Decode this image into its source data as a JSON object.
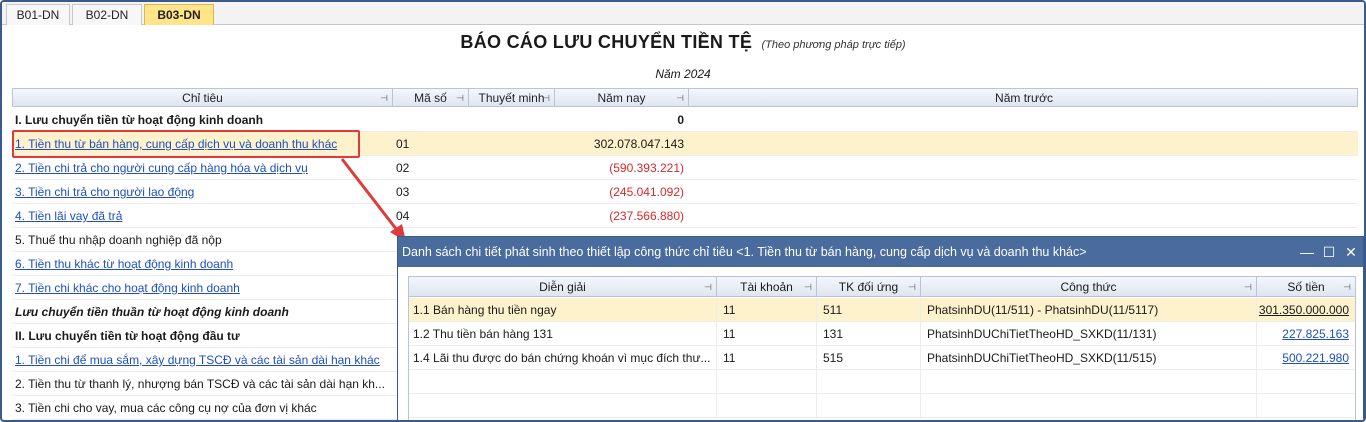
{
  "tabs": [
    "B01-DN",
    "B02-DN",
    "B03-DN"
  ],
  "report": {
    "title": "BÁO CÁO LƯU CHUYỂN TIỀN TỆ",
    "subtitle": "(Theo phương pháp trực tiếp)",
    "year": "Năm 2024"
  },
  "grid": {
    "headers": [
      "Chỉ tiêu",
      "Mã số",
      "Thuyết minh",
      "Năm nay",
      "Năm trước"
    ],
    "rows": [
      {
        "label": "I. Lưu chuyển tiền từ hoạt động kinh doanh",
        "code": "",
        "value": "0"
      },
      {
        "label": "1. Tiền thu từ bán hàng, cung cấp dịch vụ và doanh thu khác",
        "code": "01",
        "value": "302.078.047.143"
      },
      {
        "label": "2. Tiền chi trả cho người cung cấp hàng hóa và dịch vụ",
        "code": "02",
        "value": "(590.393.221)"
      },
      {
        "label": "3. Tiền chi trả cho người lao động",
        "code": "03",
        "value": "(245.041.092)"
      },
      {
        "label": "4. Tiền lãi vay đã trả",
        "code": "04",
        "value": "(237.566.880)"
      },
      {
        "label": "5. Thuế thu nhập doanh nghiệp đã nộp",
        "code": "",
        "value": ""
      },
      {
        "label": "6. Tiền thu khác từ hoạt động kinh doanh",
        "code": "",
        "value": ""
      },
      {
        "label": "7. Tiền chi khác cho hoạt động kinh doanh",
        "code": "",
        "value": ""
      },
      {
        "label": "Lưu chuyển tiền thuần từ hoạt động kinh doanh",
        "code": "",
        "value": ""
      },
      {
        "label": "II. Lưu chuyển tiền từ hoạt động đầu tư",
        "code": "",
        "value": ""
      },
      {
        "label": "1. Tiền chi để mua sắm, xây dựng TSCĐ và các tài sản dài hạn khác",
        "code": "",
        "value": ""
      },
      {
        "label": "2. Tiền thu từ thanh lý, nhượng bán TSCĐ và các tài sản dài hạn kh...",
        "code": "",
        "value": ""
      },
      {
        "label": "3. Tiền chi cho vay, mua các công cụ nợ của đơn vị khác",
        "code": "",
        "value": ""
      }
    ]
  },
  "popup": {
    "title": "Danh sách chi tiết phát sinh theo thiết lập công thức chỉ tiêu <1. Tiền thu từ bán hàng, cung cấp dịch vụ và doanh thu khác>",
    "headers": [
      "Diễn giải",
      "Tài khoản",
      "TK đối ứng",
      "Công thức",
      "Số tiền"
    ],
    "rows": [
      {
        "desc": "1.1 Bán hàng thu tiền ngay",
        "account": "11",
        "contra": "511",
        "formula": "PhatsinhDU(11/511) - PhatsinhDU(11/5117)",
        "amount": "301.350.000.000"
      },
      {
        "desc": "1.2 Thu tiền bán hàng 131",
        "account": "11",
        "contra": "131",
        "formula": "PhatsinhDUChiTietTheoHD_SXKD(11/131)",
        "amount": "227.825.163"
      },
      {
        "desc": "1.4 Lãi thu được do bán chứng khoán vì mục đích thư...",
        "account": "11",
        "contra": "515",
        "formula": "PhatsinhDUChiTietTheoHD_SXKD(11/515)",
        "amount": "500.221.980"
      }
    ]
  },
  "colors": {
    "accent": "#4a6b9d",
    "link": "#1f4fbd",
    "negative": "#d42b2b",
    "highlight": "#fdf2cc",
    "annotation": "#e03a3a"
  }
}
